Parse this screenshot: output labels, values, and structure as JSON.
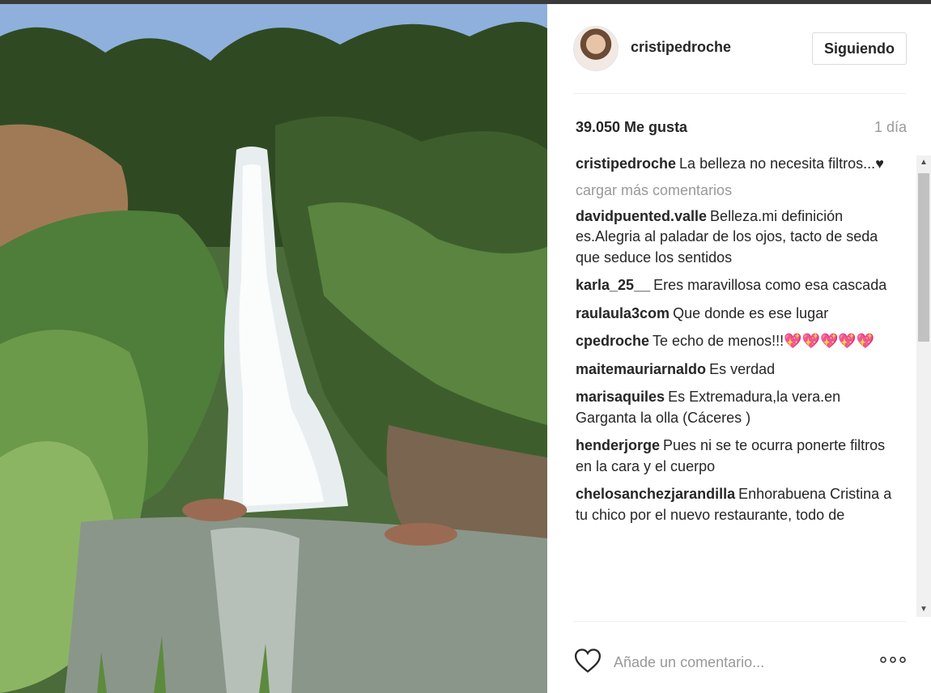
{
  "post": {
    "username": "cristipedroche",
    "follow_label": "Siguiendo",
    "likes": "39.050 Me gusta",
    "time": "1 día",
    "load_more": "cargar más comentarios",
    "add_comment_placeholder": "Añade un comentario...",
    "caption": {
      "user": "cristipedroche",
      "text": "La belleza no necesita filtros...",
      "emoji": "♥"
    },
    "comments": [
      {
        "user": "davidpuented.valle",
        "text": "Belleza.mi definición es.Alegria al paladar de los ojos, tacto de seda que seduce los sentidos"
      },
      {
        "user": "karla_25__",
        "text": "Eres maravillosa como esa cascada"
      },
      {
        "user": "raulaula3com",
        "text": "Que donde es ese lugar"
      },
      {
        "user": "cpedroche",
        "text": "Te echo de menos!!!",
        "emoji": "💖💖💖💖💖"
      },
      {
        "user": "maitemauriarnaldo",
        "text": "Es verdad"
      },
      {
        "user": "marisaquiles",
        "text": "Es Extremadura,la vera.en Garganta la olla (Cáceres )"
      },
      {
        "user": "henderjorge",
        "text": "Pues ni se te ocurra ponerte filtros en la cara y el cuerpo"
      },
      {
        "user": "chelosanchezjarandilla",
        "text": "Enhorabuena Cristina a tu chico por el nuevo restaurante, todo de"
      }
    ]
  },
  "icons": {
    "heart": "heart-outline-icon",
    "more": "more-dots-icon",
    "scroll_up": "▲",
    "scroll_down": "▼"
  },
  "colors": {
    "text": "#262626",
    "muted": "#999999",
    "border": "#dbdbdb"
  }
}
